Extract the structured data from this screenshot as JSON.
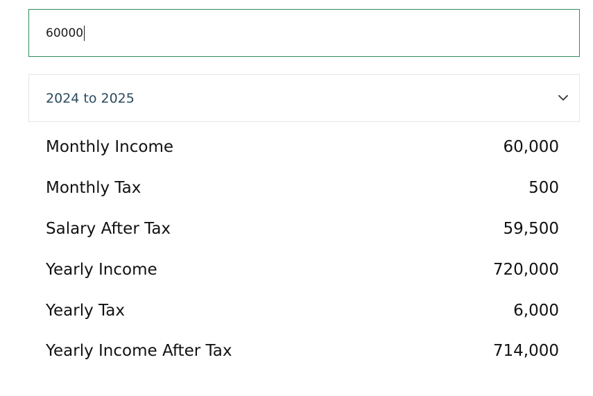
{
  "income_input": {
    "value": "60000"
  },
  "tax_year_select": {
    "selected": "2024 to 2025",
    "icon": "chevron-down-icon"
  },
  "results": [
    {
      "label": "Monthly Income",
      "value": "60,000"
    },
    {
      "label": "Monthly Tax",
      "value": "500"
    },
    {
      "label": "Salary After Tax",
      "value": "59,500"
    },
    {
      "label": "Yearly Income",
      "value": "720,000"
    },
    {
      "label": "Yearly Tax",
      "value": "6,000"
    },
    {
      "label": "Yearly Income After Tax",
      "value": "714,000"
    }
  ],
  "colors": {
    "input_border": "#2e8b57",
    "select_border": "#e6e6e6",
    "select_text": "#2a4a5e",
    "text": "#111111"
  }
}
